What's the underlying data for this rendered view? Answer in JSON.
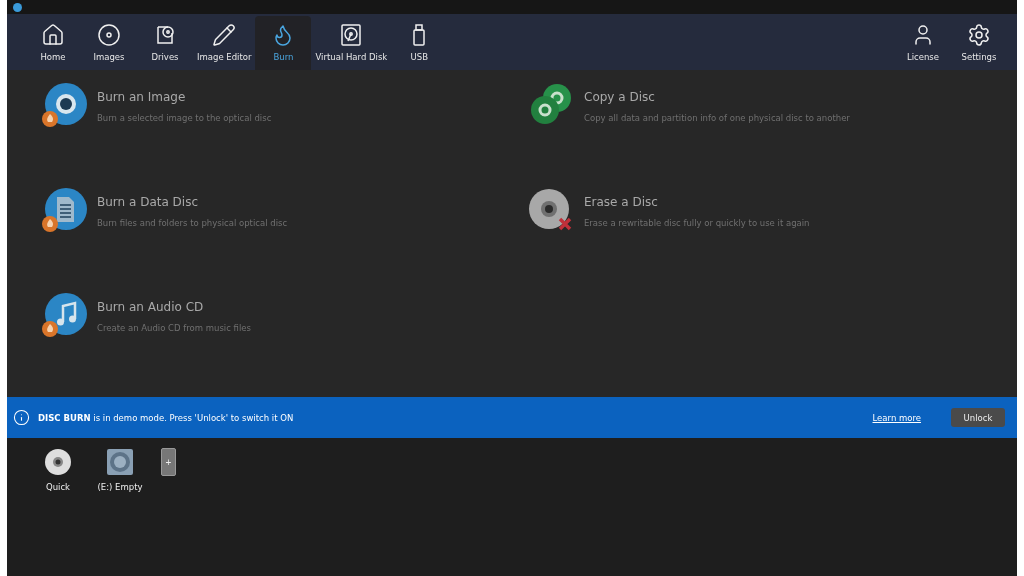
{
  "nav": {
    "tabs": [
      {
        "label": "Home",
        "selected": false
      },
      {
        "label": "Images",
        "selected": false
      },
      {
        "label": "Drives",
        "selected": false
      },
      {
        "label": "Image Editor",
        "selected": false
      },
      {
        "label": "Burn",
        "selected": true
      },
      {
        "label": "Virtual Hard Disk",
        "selected": false
      },
      {
        "label": "USB",
        "selected": false
      }
    ],
    "right_tabs": [
      {
        "label": "License",
        "selected": false
      },
      {
        "label": "Settings",
        "selected": false
      }
    ]
  },
  "tasks": [
    {
      "kind": "burn-image",
      "title": "Burn an Image",
      "description": "Burn a selected image to the optical disc"
    },
    {
      "kind": "burn-data",
      "title": "Burn a Data Disc",
      "description": "Burn files and folders to physical optical disc"
    },
    {
      "kind": "burn-audio",
      "title": "Burn an Audio CD",
      "description": "Create an Audio CD from music files"
    },
    {
      "kind": "copy",
      "title": "Copy a Disc",
      "description": "Copy all data and partition info of one physical disc to another"
    },
    {
      "kind": "erase",
      "title": "Erase a Disc",
      "description": "Erase a rewritable disc fully or quickly to use it again"
    }
  ],
  "banner": {
    "message": "**DISC BURN** is in demo mode. Press 'Unlock' to switch it ON",
    "link": "Learn more",
    "button": "Unlock"
  },
  "dock": [
    {
      "kind": "disc",
      "label": "Quick"
    },
    {
      "kind": "drive",
      "label": "(E:) Empty"
    },
    {
      "kind": "add",
      "label": "+"
    }
  ]
}
